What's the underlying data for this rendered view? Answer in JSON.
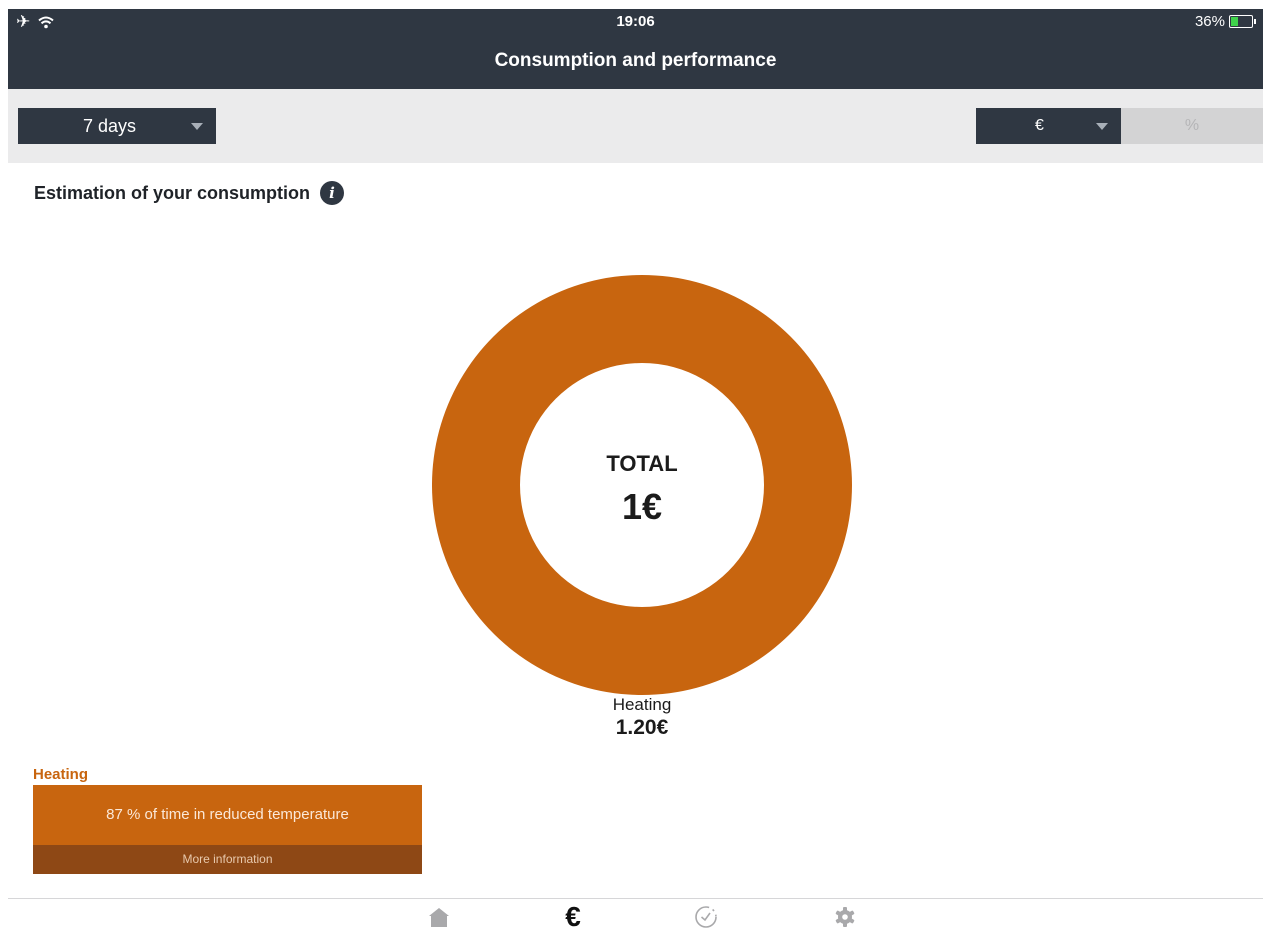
{
  "status_bar": {
    "time": "19:06",
    "battery": "36%",
    "battery_level": 0.36
  },
  "header": {
    "title": "Consumption and performance"
  },
  "filters": {
    "period": "7 days",
    "unit_selected": "€",
    "unit_alt": "%"
  },
  "section": {
    "title": "Estimation of your consumption"
  },
  "chart_data": {
    "type": "pie",
    "categories": [
      "Heating"
    ],
    "values": [
      1.2
    ],
    "value_labels": [
      "1.20€"
    ],
    "center_label": "TOTAL",
    "center_value": "1€",
    "colors": [
      "#c8650f"
    ]
  },
  "heating_card": {
    "heading": "Heating",
    "message": "87 % of time  in reduced temperature",
    "more": "More information"
  },
  "tabs": [
    {
      "icon": "home-icon",
      "active": false
    },
    {
      "icon": "euro-icon",
      "active": true
    },
    {
      "icon": "timer-icon",
      "active": false
    },
    {
      "icon": "gear-icon",
      "active": false
    }
  ],
  "colors": {
    "header_bg": "#2f3742",
    "accent": "#c8650f",
    "accent_dark": "#8e4815",
    "filter_bg": "#ebebec"
  }
}
